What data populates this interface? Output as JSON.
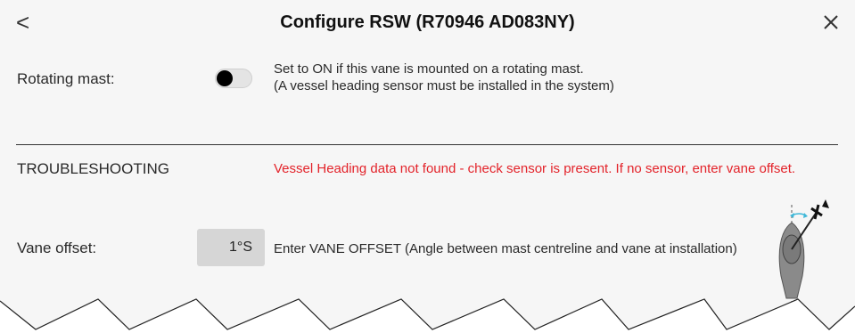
{
  "header": {
    "back_glyph": "<",
    "title": "Configure RSW (R70946 AD083NY)"
  },
  "rotating_mast": {
    "label": "Rotating mast:",
    "toggle_on": false,
    "description_line1": "Set to ON if this vane is mounted on a rotating mast.",
    "description_line2": "(A vessel heading sensor must be installed in the system)"
  },
  "troubleshooting": {
    "heading": "TROUBLESHOOTING",
    "warning": "Vessel Heading data not found - check sensor is present. If no sensor, enter vane offset."
  },
  "vane_offset": {
    "label": "Vane offset:",
    "value": "1°S",
    "description": "Enter VANE OFFSET (Angle between mast centreline and vane at installation)"
  },
  "colors": {
    "warning": "#e3232a",
    "accent_cyan": "#3fb8d8",
    "boat_fill": "#8a8a8a"
  },
  "icons": {
    "back": "chevron-left-icon",
    "close": "close-icon",
    "diagram": "boat-vane-diagram-icon"
  }
}
